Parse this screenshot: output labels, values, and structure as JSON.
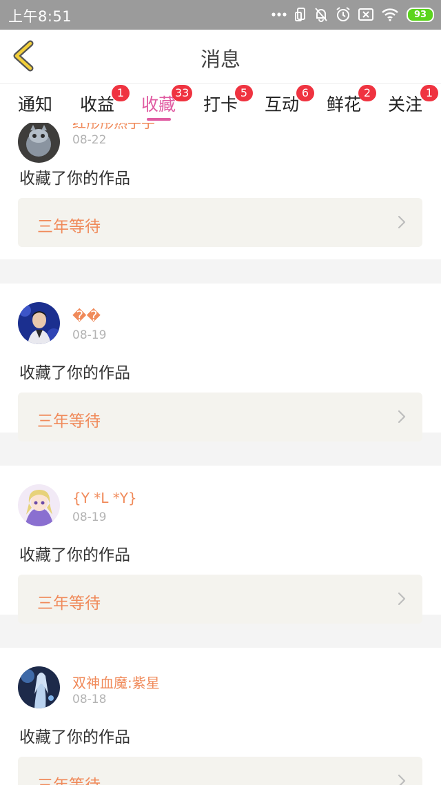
{
  "status_bar": {
    "time": "上午8:51",
    "battery": "93",
    "icons": [
      "more-dots-icon",
      "screen-rotate-icon",
      "mute-bell-icon",
      "alarm-icon",
      "sim-off-icon",
      "wifi-icon",
      "battery-icon"
    ]
  },
  "header": {
    "title": "消息",
    "back_icon": "chevron-left-icon"
  },
  "tabs": [
    {
      "label": "通知",
      "badge": ""
    },
    {
      "label": "收益",
      "badge": "1"
    },
    {
      "label": "收藏",
      "badge": "33",
      "active": true
    },
    {
      "label": "打卡",
      "badge": "5"
    },
    {
      "label": "互动",
      "badge": "6"
    },
    {
      "label": "鲜花",
      "badge": "2"
    },
    {
      "label": "关注",
      "badge": "1"
    }
  ],
  "colors": {
    "accent": "#e05ca2",
    "badge": "#ef3340",
    "username": "#f08a5a",
    "status_bar": "#9b9b9b",
    "battery": "#5bd41d"
  },
  "feed": [
    {
      "user": "红彤彤热乎乎",
      "date": "08-22",
      "action": "收藏了你的作品",
      "work": "三年等待"
    },
    {
      "user": "��",
      "date": "08-19",
      "action": "收藏了你的作品",
      "work": "三年等待"
    },
    {
      "user": "{Y *L *Y}",
      "date": "08-19",
      "action": "收藏了你的作品",
      "work": "三年等待"
    },
    {
      "user": "双神血魔:紫星",
      "date": "08-18",
      "action": "收藏了你的作品",
      "work": "三年等待"
    }
  ]
}
